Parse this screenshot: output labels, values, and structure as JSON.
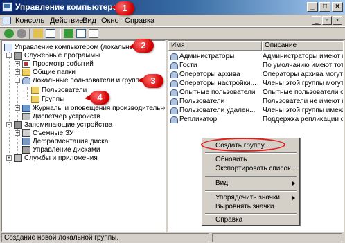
{
  "window": {
    "title": "Управление компьютером"
  },
  "menubar": {
    "items": [
      "Консоль",
      "Действие",
      "Вид",
      "Окно",
      "Справка"
    ]
  },
  "mdi_buttons": [
    "_",
    "▫",
    "×"
  ],
  "window_buttons": [
    "_",
    "□",
    "×"
  ],
  "tree": {
    "items": [
      {
        "label": "Управление компьютером (локальным)"
      },
      {
        "label": "Служебные программы"
      },
      {
        "label": "Просмотр событий"
      },
      {
        "label": "Общие папки"
      },
      {
        "label": "Локальные пользователи и группы"
      },
      {
        "label": "Пользователи"
      },
      {
        "label": "Группы"
      },
      {
        "label": "Журналы и оповещения производительности"
      },
      {
        "label": "Диспетчер устройств"
      },
      {
        "label": "Запоминающие устройства"
      },
      {
        "label": "Съемные ЗУ"
      },
      {
        "label": "Дефрагментация диска"
      },
      {
        "label": "Управление дисками"
      },
      {
        "label": "Службы и приложения"
      }
    ]
  },
  "list": {
    "columns": [
      "Имя",
      "Описание"
    ],
    "rows": [
      {
        "name": "Администраторы",
        "desc": "Администраторы имеют полн"
      },
      {
        "name": "Гости",
        "desc": "По умолчанию имеют тот же"
      },
      {
        "name": "Операторы архива",
        "desc": "Операторы архива могут перекр"
      },
      {
        "name": "Операторы настройки...",
        "desc": "Члены этой группы могут иметь"
      },
      {
        "name": "Опытные пользователи",
        "desc": "Опытные пользователи облада"
      },
      {
        "name": "Пользователи",
        "desc": "Пользователи не имеют права"
      },
      {
        "name": "Пользователи удален...",
        "desc": "Члены этой группы имеют пра"
      },
      {
        "name": "Репликатор",
        "desc": "Поддержка репликации файлов"
      }
    ]
  },
  "context_menu": {
    "create_group": "Создать группу...",
    "refresh": "Обновить",
    "export": "Экспортировать список...",
    "view": "Вид",
    "arrange": "Упорядочить значки",
    "align": "Выровнять значки",
    "help": "Справка"
  },
  "statusbar": {
    "text": "Создание новой локальной группы."
  },
  "callouts": [
    "1",
    "2",
    "3",
    "4"
  ],
  "colors": {
    "callout": "#d00000",
    "title_start": "#0a246a",
    "title_end": "#a6caf0"
  }
}
